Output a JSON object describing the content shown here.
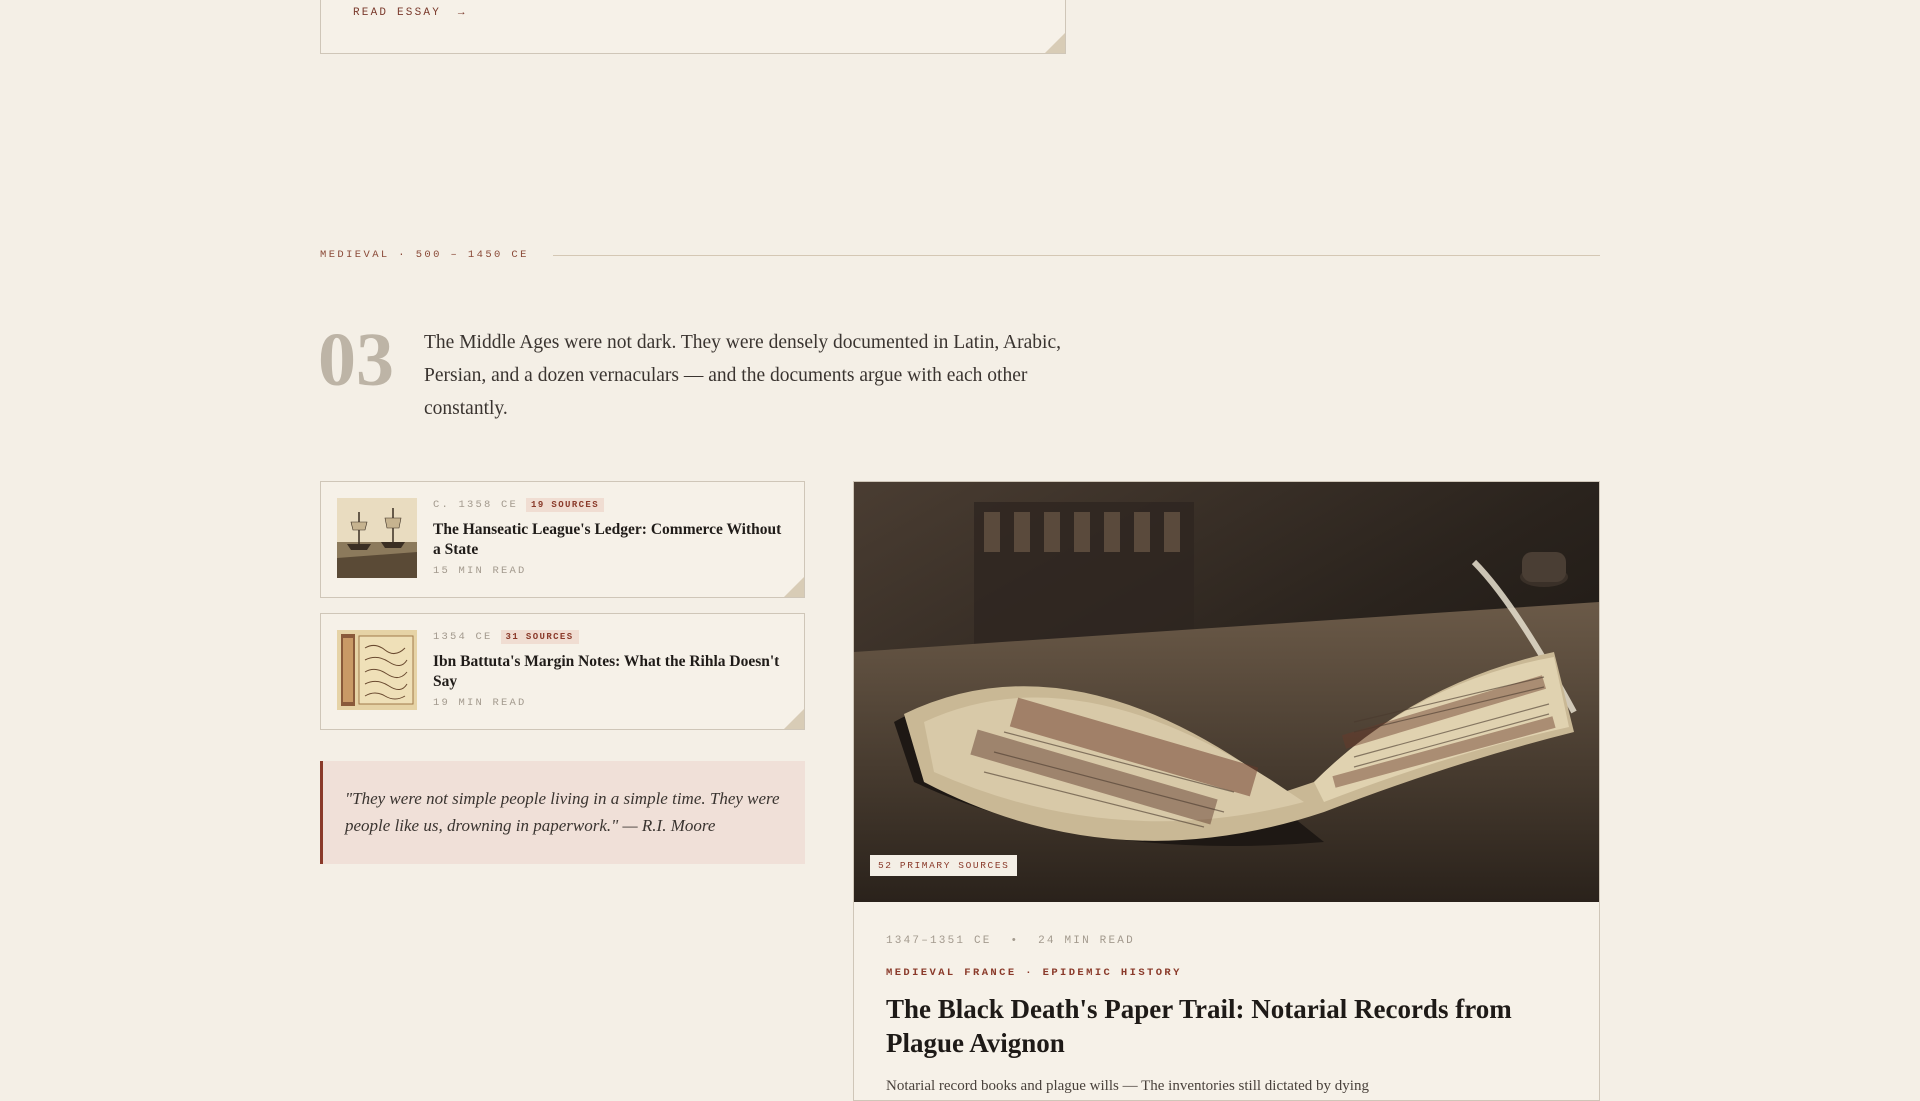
{
  "previous_card": {
    "read_label": "READ ESSAY",
    "arrow": "→"
  },
  "section": {
    "label": "MEDIEVAL · 500 – 1450 CE",
    "number": "03",
    "intro": "The Middle Ages were not dark. They were densely documented in Latin, Arabic, Persian, and a dozen vernaculars — and the documents argue with each other constantly."
  },
  "articles": [
    {
      "date": "C. 1358 CE",
      "sources": "19 SOURCES",
      "title": "The Hanseatic League's Ledger: Commerce Without a State",
      "read_time": "15 MIN READ",
      "thumb": "ships-harbor-image"
    },
    {
      "date": "1354 CE",
      "sources": "31 SOURCES",
      "title": "Ibn Battuta's Margin Notes: What the Rihla Doesn't Say",
      "read_time": "19 MIN READ",
      "thumb": "manuscript-page-image"
    }
  ],
  "quote": {
    "text": "\"They were not simple people living in a simple time. They were people like us, drowning in paperwork.\" — R.I. Moore"
  },
  "featured": {
    "image_badge": "52 PRIMARY SOURCES",
    "dates": "1347–1351 CE",
    "separator": "•",
    "read_time": "24 MIN READ",
    "categories": "MEDIEVAL FRANCE · EPIDEMIC HISTORY",
    "title": "The Black Death's Paper Trail: Notarial Records from Plague Avignon",
    "excerpt": "Notarial record books and plague wills — The inventories still dictated by dying",
    "image": "illuminated-manuscript-image"
  },
  "colors": {
    "background": "#f4efe6",
    "accent": "#8a3a2a",
    "muted": "#a39a8e",
    "border": "#cfc6b8"
  }
}
